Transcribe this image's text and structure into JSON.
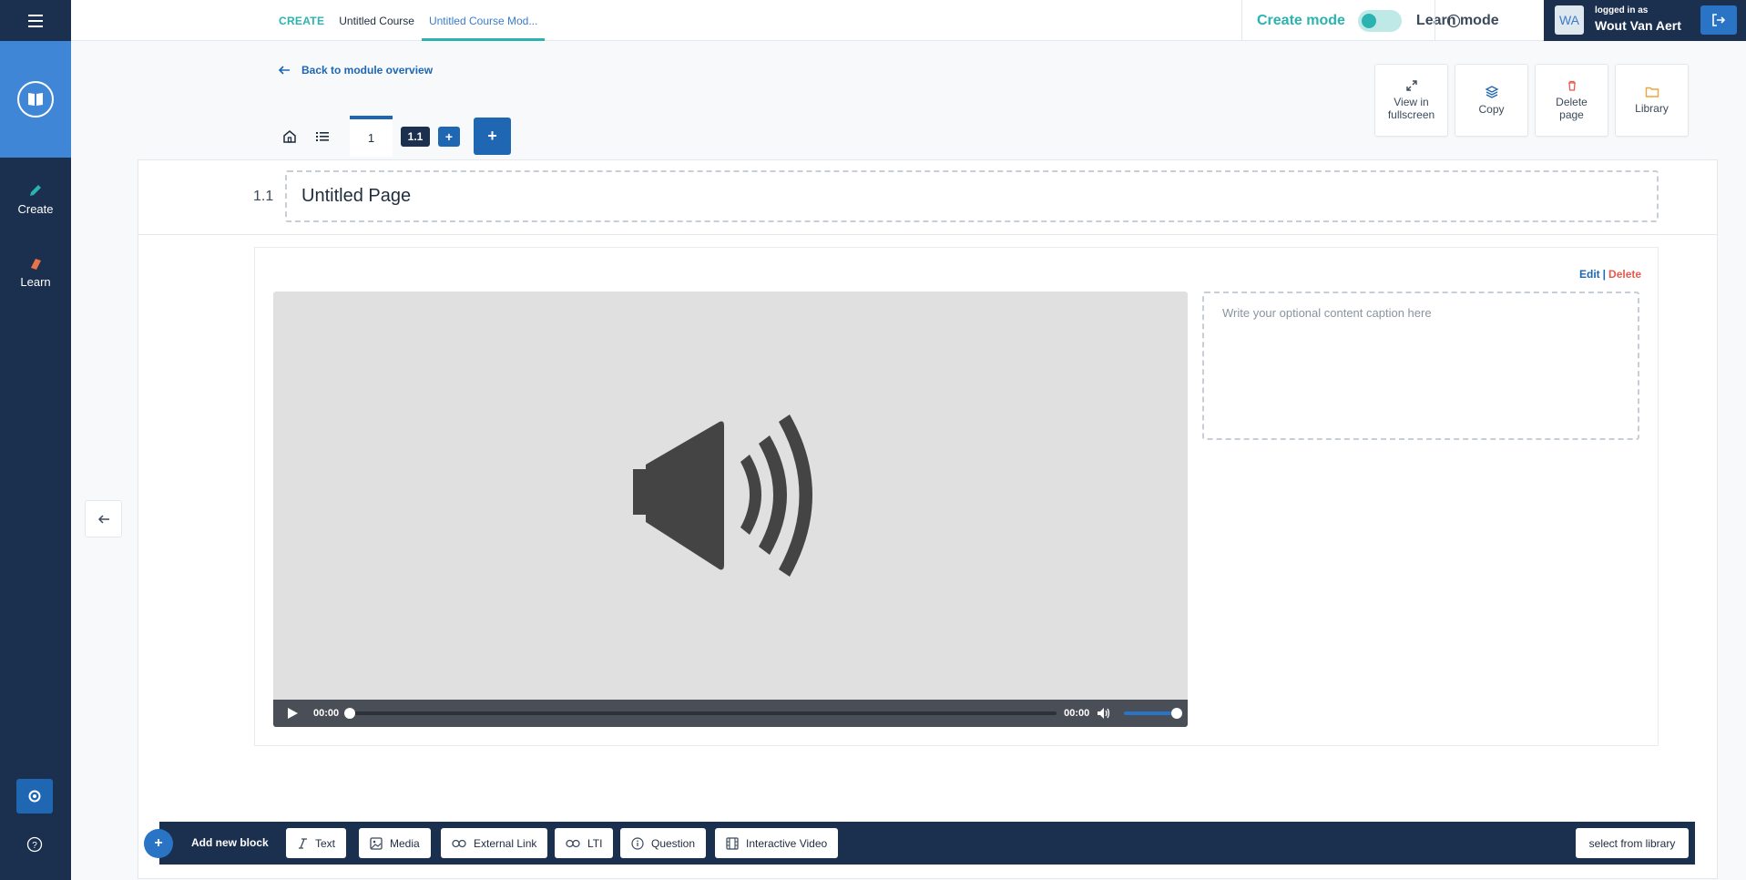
{
  "app": {
    "colors": {
      "navy": "#1b2f4e",
      "blue": "#1f66b3",
      "teal": "#2bb3b1",
      "danger": "#e55a4e"
    }
  },
  "sidebar": {
    "items": [
      {
        "label": "Create",
        "icon": "pencil-icon"
      },
      {
        "label": "Learn",
        "icon": "eraser-icon"
      }
    ],
    "logo_icon": "book-icon",
    "settings_icon": "gear-icon",
    "help_icon": "help-icon"
  },
  "topbar": {
    "breadcrumbs": [
      "CREATE",
      "Untitled Course",
      "Untitled Course Mod..."
    ],
    "mode_create": "Create mode",
    "mode_learn": "Learn mode",
    "user": {
      "initials": "WA",
      "logged_in_as": "logged in as",
      "name": "Wout Van Aert"
    }
  },
  "back_link": "Back to module overview",
  "page_tabs": {
    "tab_label": "1",
    "badge": "1.1",
    "small_plus": "+",
    "big_plus": "+"
  },
  "actions": [
    {
      "label": "View in fullscreen",
      "icon": "expand-icon"
    },
    {
      "label": "Copy",
      "icon": "layers-icon"
    },
    {
      "label": "Delete page",
      "icon": "trash-icon"
    },
    {
      "label": "Library",
      "icon": "folder-icon"
    }
  ],
  "page": {
    "number": "1.1",
    "title": "Untitled Page"
  },
  "block": {
    "edit": "Edit",
    "separator": "|",
    "delete": "Delete",
    "caption_placeholder": "Write your optional content caption here",
    "player": {
      "current_time": "00:00",
      "duration": "00:00",
      "progress": 0,
      "volume": 1.0
    }
  },
  "bottom_toolbar": {
    "plus": "+",
    "add_label": "Add new block",
    "tools": [
      "Text",
      "Media",
      "External Link",
      "LTI",
      "Question",
      "Interactive Video"
    ],
    "library_button": "select from library"
  }
}
